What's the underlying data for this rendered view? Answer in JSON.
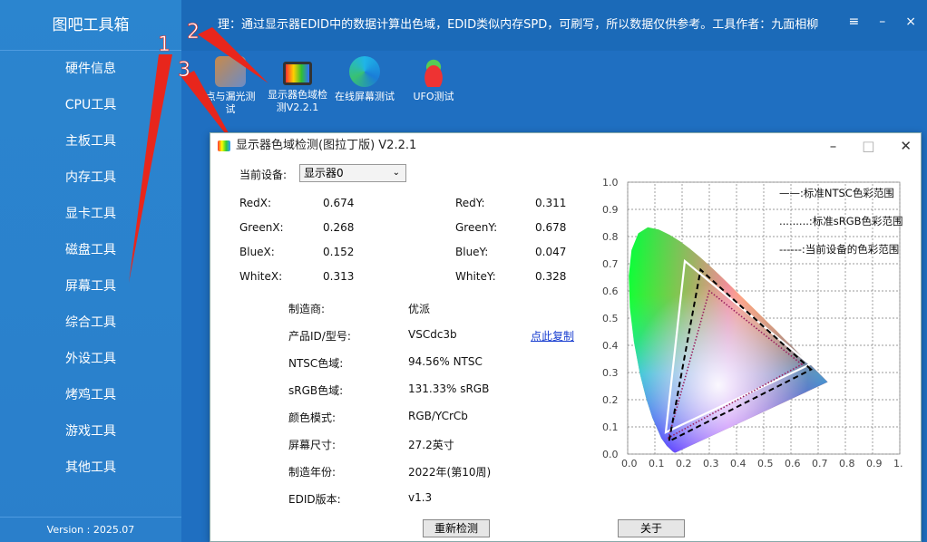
{
  "sidebar": {
    "title": "图吧工具箱",
    "items": [
      "硬件信息",
      "CPU工具",
      "主板工具",
      "内存工具",
      "显卡工具",
      "磁盘工具",
      "屏幕工具",
      "综合工具",
      "外设工具",
      "烤鸡工具",
      "游戏工具",
      "其他工具"
    ],
    "version": "Version : 2025.07"
  },
  "topbar": {
    "notice": "理：通过显示器EDID中的数据计算出色域，EDID类似内存SPD，可刷写，所以数据仅供参考。工具作者：九面相柳",
    "menu_icon": "≡",
    "minimize": "–",
    "close": "×"
  },
  "tools": [
    {
      "label": "点与漏光测试",
      "icon": "pixel-test-icon"
    },
    {
      "label": "显示器色域检测V2.2.1",
      "icon": "monitor-gamut-icon"
    },
    {
      "label": "在线屏幕测试",
      "icon": "edge-browser-icon"
    },
    {
      "label": "UFO测试",
      "icon": "ufo-icon"
    }
  ],
  "annotations": [
    "1",
    "2",
    "3"
  ],
  "dialog": {
    "title": "显示器色域检测(图拉丁版) V2.2.1",
    "device_label": "当前设备:",
    "device_value": "显示器0",
    "coords": [
      {
        "k1": "RedX:",
        "v1": "0.674",
        "k2": "RedY:",
        "v2": "0.311"
      },
      {
        "k1": "GreenX:",
        "v1": "0.268",
        "k2": "GreenY:",
        "v2": "0.678"
      },
      {
        "k1": "BlueX:",
        "v1": "0.152",
        "k2": "BlueY:",
        "v2": "0.047"
      },
      {
        "k1": "WhiteX:",
        "v1": "0.313",
        "k2": "WhiteY:",
        "v2": "0.328"
      }
    ],
    "info": [
      {
        "k": "制造商:",
        "v": "优派"
      },
      {
        "k": "产品ID/型号:",
        "v": "VSCdc3b"
      },
      {
        "k": "NTSC色域:",
        "v": "94.56% NTSC"
      },
      {
        "k": "sRGB色域:",
        "v": "131.33% sRGB"
      },
      {
        "k": "颜色模式:",
        "v": "RGB/YCrCb"
      },
      {
        "k": "屏幕尺寸:",
        "v": "27.2英寸"
      },
      {
        "k": "制造年份:",
        "v": "2022年(第10周)"
      },
      {
        "k": "EDID版本:",
        "v": "v1.3"
      }
    ],
    "copy_link": "点此复制",
    "redetect_button": "重新检测",
    "about_button": "关于",
    "legend": [
      "——:标准NTSC色彩范围",
      ".........:标准sRGB色彩范围",
      "------:当前设备的色彩范围"
    ],
    "chart_ticks_x": [
      "0.0",
      "0.1",
      "0.2",
      "0.3",
      "0.4",
      "0.5",
      "0.6",
      "0.7",
      "0.8",
      "0.9",
      "1."
    ],
    "chart_ticks_y": [
      "1.0",
      "0.9",
      "0.8",
      "0.7",
      "0.6",
      "0.5",
      "0.4",
      "0.3",
      "0.2",
      "0.1",
      "0.0"
    ]
  },
  "colors": {
    "sidebar": "#2b85cf",
    "topbar": "#1b6ab8",
    "arrow": "#e8261c"
  }
}
